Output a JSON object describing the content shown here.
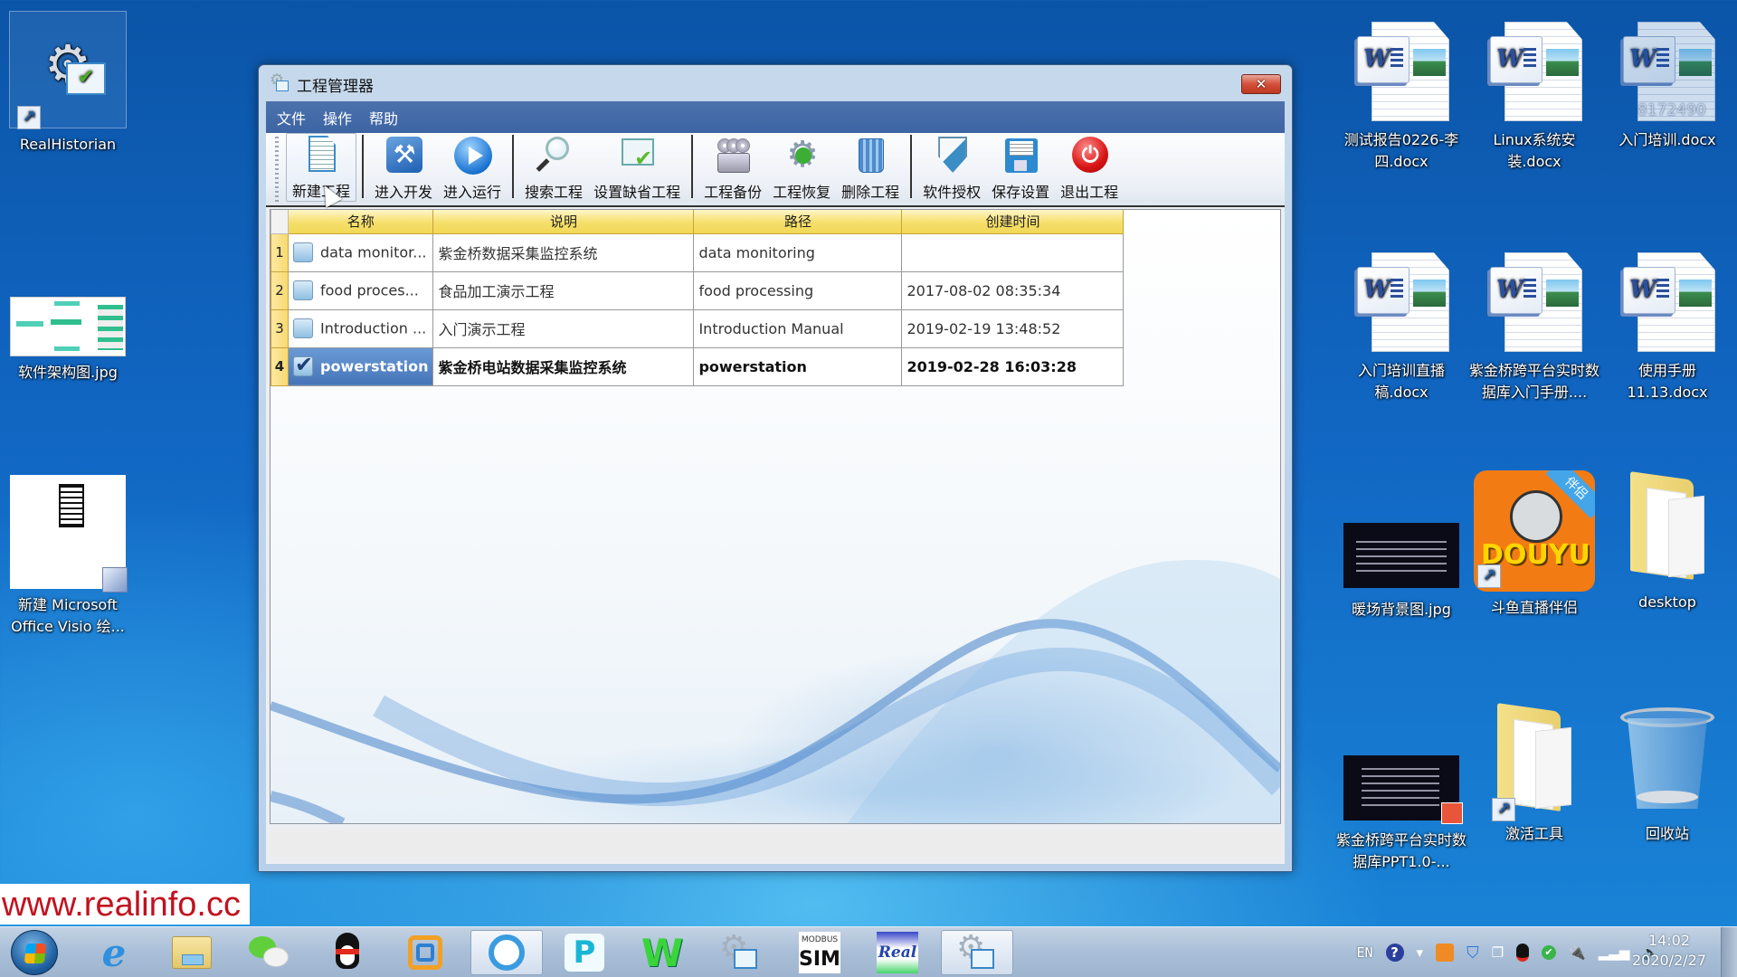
{
  "desktop": {
    "left_icons": [
      {
        "label": "RealHistorian",
        "icon": "realhistorian-app-icon",
        "shortcut": true
      },
      {
        "label": "软件架构图.jpg",
        "icon": "image-thumbnail-icon",
        "shortcut": false
      },
      {
        "label": "新建 Microsoft Office Visio 绘...",
        "icon": "visio-document-icon",
        "shortcut": false
      }
    ],
    "right_icons": [
      {
        "label": "测试报告0226-李四.docx",
        "icon": "word-document-icon"
      },
      {
        "label": "Linux系统安装.docx",
        "icon": "word-document-icon"
      },
      {
        "label": "入门培训.docx",
        "icon": "word-document-icon",
        "overlay_text": "8172490"
      },
      {
        "label": "入门培训直播稿.docx",
        "icon": "word-document-icon"
      },
      {
        "label": "紫金桥跨平台实时数据库入门手册....",
        "icon": "word-document-icon"
      },
      {
        "label": "使用手册11.13.docx",
        "icon": "word-document-icon"
      },
      {
        "label": "暖场背景图.jpg",
        "icon": "image-thumbnail-icon"
      },
      {
        "label": "斗鱼直播伴侣",
        "icon": "douyu-app-icon",
        "shortcut": true,
        "badge": "伴侣",
        "logo_text": "DOUYU"
      },
      {
        "label": "desktop",
        "icon": "folder-icon"
      },
      {
        "label": "紫金桥跨平台实时数据库PPT1.0-...",
        "icon": "powerpoint-document-icon"
      },
      {
        "label": "激活工具",
        "icon": "folder-icon",
        "shortcut": true
      },
      {
        "label": "回收站",
        "icon": "recycle-bin-icon"
      }
    ]
  },
  "window": {
    "title": "工程管理器",
    "close_symbol": "✕",
    "menu": [
      "文件",
      "操作",
      "帮助"
    ],
    "toolbar": [
      {
        "label": "新建工程",
        "icon": "new-project-icon"
      },
      {
        "label": "进入开发",
        "icon": "develop-tools-icon"
      },
      {
        "label": "进入运行",
        "icon": "run-play-icon"
      },
      {
        "label": "搜索工程",
        "icon": "search-icon"
      },
      {
        "label": "设置缺省工程",
        "icon": "set-default-icon"
      },
      {
        "label": "工程备份",
        "icon": "backup-icon"
      },
      {
        "label": "工程恢复",
        "icon": "restore-gear-icon"
      },
      {
        "label": "删除工程",
        "icon": "trash-icon"
      },
      {
        "label": "软件授权",
        "icon": "license-shield-icon"
      },
      {
        "label": "保存设置",
        "icon": "save-floppy-icon"
      },
      {
        "label": "退出工程",
        "icon": "power-exit-icon"
      }
    ],
    "table": {
      "columns": [
        "名称",
        "说明",
        "路径",
        "创建时间"
      ],
      "rows": [
        {
          "num": "1",
          "checked": false,
          "name": "data monitor...",
          "desc": "紫金桥数据采集监控系统",
          "path": "data monitoring",
          "time": ""
        },
        {
          "num": "2",
          "checked": false,
          "name": "food proces...",
          "desc": "食品加工演示工程",
          "path": "food processing",
          "time": "2017-08-02 08:35:34"
        },
        {
          "num": "3",
          "checked": false,
          "name": "Introduction ...",
          "desc": "入门演示工程",
          "path": "Introduction Manual",
          "time": "2019-02-19 13:48:52"
        },
        {
          "num": "4",
          "checked": true,
          "name": "powerstation",
          "desc": "紫金桥电站数据采集监控系统",
          "path": "powerstation",
          "time": "2019-02-28 16:03:28"
        }
      ],
      "selected_row": 4
    }
  },
  "watermark": "www.realinfo.cc",
  "taskbar": {
    "apps": [
      {
        "name": "internet-explorer",
        "glyph": "e",
        "color": "#2f8fe0"
      },
      {
        "name": "file-explorer",
        "glyph": "▬",
        "color": "#e9c95c"
      },
      {
        "name": "wechat",
        "glyph": "••",
        "color": "#5fd03b"
      },
      {
        "name": "qq",
        "glyph": "🐧",
        "color": "#111111"
      },
      {
        "name": "vmware",
        "glyph": "▣",
        "color": "#f2a024"
      },
      {
        "name": "browser-cloud",
        "glyph": "◔",
        "color": "#3a9be0",
        "open": true
      },
      {
        "name": "p-app",
        "glyph": "P",
        "color": "#1bb6d6"
      },
      {
        "name": "w-app",
        "glyph": "W",
        "color": "#3bd43b"
      },
      {
        "name": "realhistorian",
        "glyph": "⚙",
        "color": "#8a9bb0"
      },
      {
        "name": "modbus-sim",
        "glyph": "SIM",
        "top_text": "MODBUS",
        "color": "#222222"
      },
      {
        "name": "real-app",
        "glyph": "Real",
        "color": "#2244aa"
      },
      {
        "name": "project-manager",
        "glyph": "⚙",
        "color": "#8a9bb0",
        "open": true
      }
    ],
    "tray": {
      "language": "EN",
      "icons": [
        "help-icon",
        "show-hidden-icon",
        "app-tray-icon",
        "security-shield-icon",
        "network-manager-icon",
        "qq-tray-icon",
        "usb-safe-remove-icon",
        "power-plug-icon",
        "signal-icon",
        "volume-icon"
      ]
    },
    "clock": {
      "time": "14:02",
      "date": "2020/2/27"
    }
  }
}
